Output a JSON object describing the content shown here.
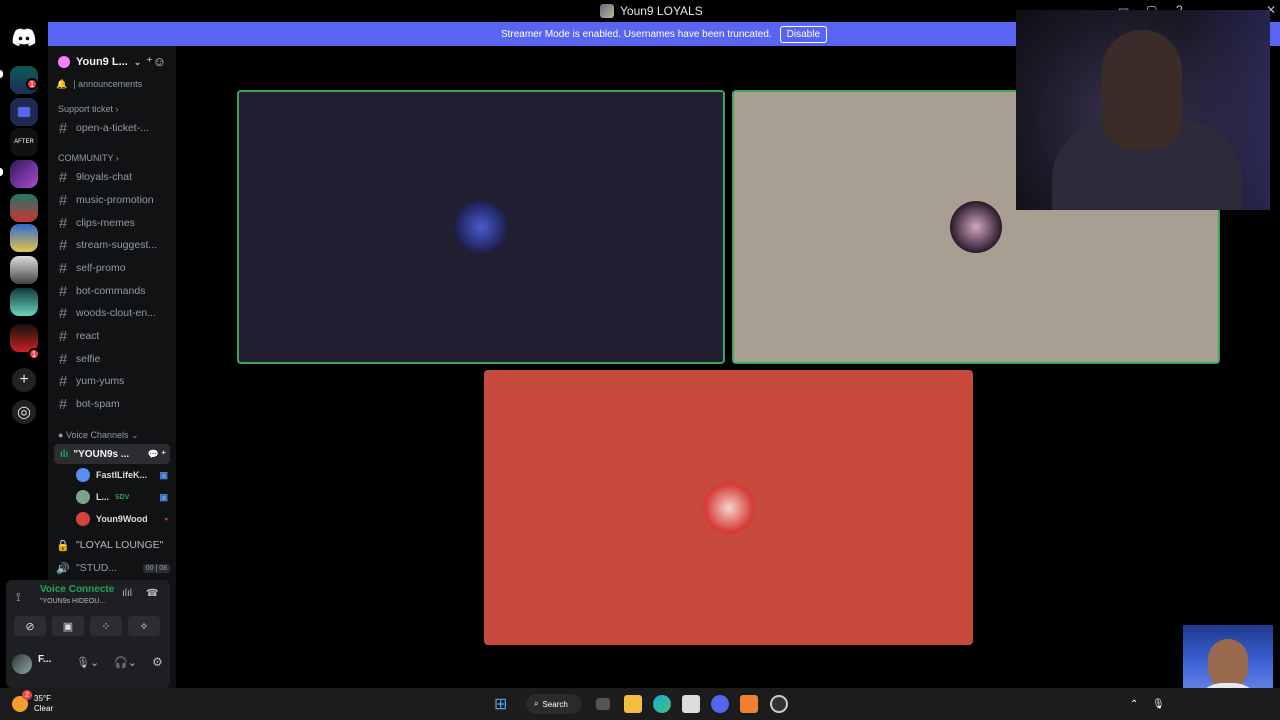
{
  "window": {
    "title": "Youn9 LOYALS"
  },
  "banner": {
    "text": "Streamer Mode is enabled. Usernames have been truncated.",
    "disable_label": "Disable"
  },
  "guild_badges": {
    "top": "1",
    "bottom": "1"
  },
  "server": {
    "name": "Youn9 L..."
  },
  "channels": {
    "top_partial": "| announcements",
    "cat_support": "Support ticket",
    "support": [
      "open-a-ticket-..."
    ],
    "cat_community": "COMMUNITY",
    "community": [
      "9loyals-chat",
      "music-promotion",
      "clips-memes",
      "stream-suggest...",
      "self-promo",
      "bot-commands",
      "woods-clout-en...",
      "react",
      "selfie",
      "yum-yums",
      "bot-spam"
    ],
    "cat_voice": "Voice Channels",
    "voice_active": "\"YOUN9s ...",
    "voice_users": [
      {
        "name": "FastlLifeK...",
        "color": "#5b8def"
      },
      {
        "name": "L...",
        "tag": "SDV",
        "color": "#7aa38a"
      },
      {
        "name": "Youn9Wood",
        "color": "#d0463b"
      }
    ],
    "voice_locked": "\"LOYAL LOUNGE\"",
    "voice_studio": "\"STUD...",
    "voice_studio_count_a": "00",
    "voice_studio_count_b": "08"
  },
  "voice_panel": {
    "status": "Voice Connected",
    "channel": "\"YOUN9s HIDEOU...",
    "user": "F..."
  },
  "tiles": [
    {
      "bg": "#231f33",
      "border": "#3ba55d"
    },
    {
      "bg": "#a89e91",
      "border": "#3ba55d"
    },
    {
      "bg": "#c84a3c",
      "border": "none"
    }
  ],
  "taskbar": {
    "temp": "35°F",
    "weather": "Clear",
    "search": "Search",
    "weather_badge": "2"
  },
  "colors": {
    "blurple": "#5865f2",
    "green": "#23a55a",
    "red": "#f23f42"
  }
}
